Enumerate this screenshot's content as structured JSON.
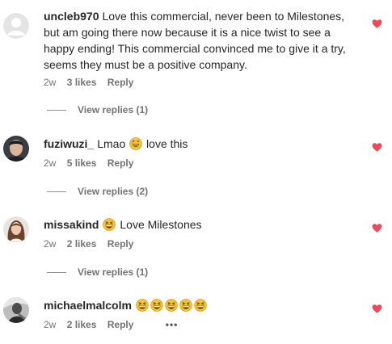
{
  "colors": {
    "heart": "#ed4956",
    "meta_text": "#737373",
    "body_text": "#262626"
  },
  "comments": [
    {
      "username": "uncleb970",
      "text": "Love this commercial, never been to Milestones, but am going there now because it is a nice twist to see a happy ending! This commercial convinced me to give it a try, seems they must be a positive company.",
      "time": "2w",
      "likes": "3 likes",
      "reply": "Reply",
      "view_replies": "View replies (1)",
      "avatar": "default-avatar-icon",
      "liked": true
    },
    {
      "username": "fuziwuzi_",
      "text_before": "Lmao",
      "emoji": "rolling-on-floor-laughing-icon",
      "text_after": "love this",
      "time": "2w",
      "likes": "5 likes",
      "reply": "Reply",
      "view_replies": "View replies (2)",
      "avatar": "user-photo-avatar",
      "liked": true
    },
    {
      "username": "missakind",
      "emoji": "grinning-squinting-icon",
      "text_after": "Love Milestones",
      "time": "2w",
      "likes": "2 likes",
      "reply": "Reply",
      "view_replies": "View replies (1)",
      "avatar": "user-photo-avatar",
      "liked": true
    },
    {
      "username": "michaelmalcolm",
      "emoji_count": 5,
      "emoji": "grinning-squinting-icon",
      "time": "2w",
      "likes": "2 likes",
      "reply": "Reply",
      "more": "•••",
      "avatar": "user-photo-avatar",
      "liked": true
    }
  ]
}
